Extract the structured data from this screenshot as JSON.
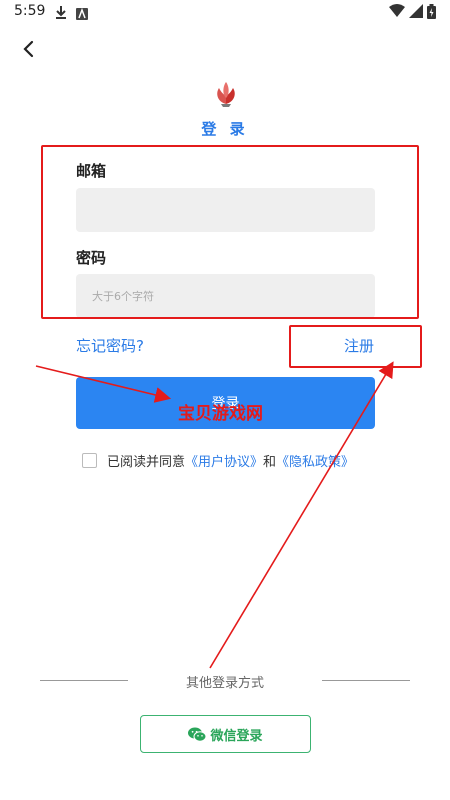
{
  "status_bar": {
    "time": "5:59"
  },
  "header": {
    "title": "登 录"
  },
  "form": {
    "email_label": "邮箱",
    "email_value": "",
    "email_placeholder": "",
    "password_label": "密码",
    "password_value": "",
    "password_placeholder": "大于6个字符"
  },
  "links": {
    "forgot": "忘记密码?",
    "register": "注册"
  },
  "login_button": {
    "label": "登录"
  },
  "watermark": {
    "text": "宝贝游戏网"
  },
  "agreement": {
    "prefix": "已阅读并同意",
    "user_agreement": "《用户协议》",
    "and": "和",
    "privacy_policy": "《隐私政策》",
    "checked": false
  },
  "other_login": {
    "label": "其他登录方式",
    "wechat": "微信登录"
  },
  "colors": {
    "accent": "#2b85f2",
    "link": "#2b7be6",
    "annotation": "#e41b1b",
    "wechat": "#3cb371"
  }
}
